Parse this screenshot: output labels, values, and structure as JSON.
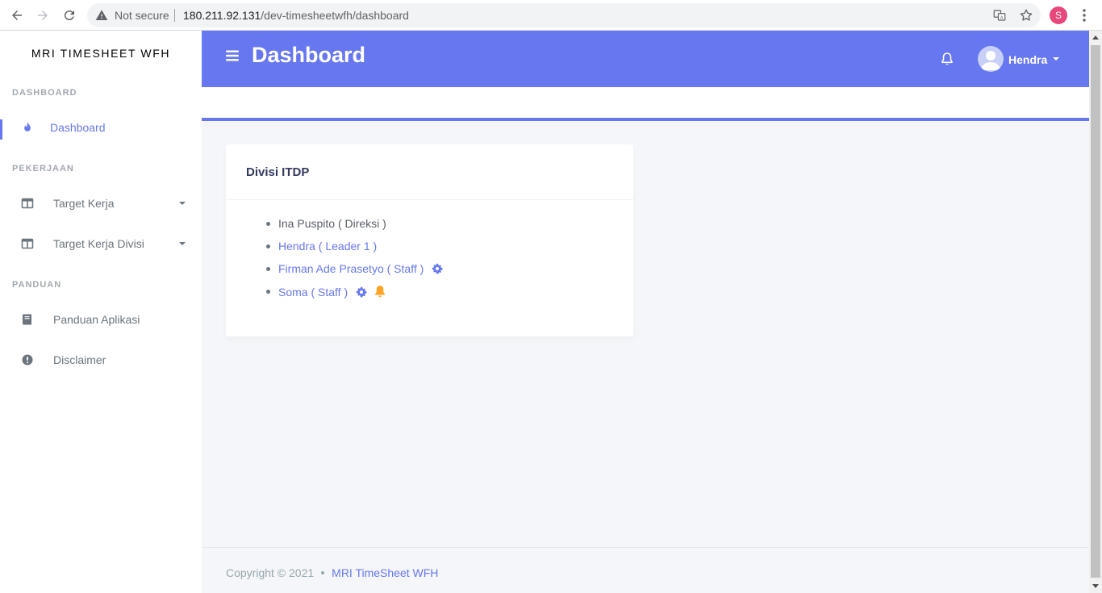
{
  "browser": {
    "security_label": "Not secure",
    "url_host": "180.211.92.131",
    "url_path": "/dev-timesheetwfh/dashboard",
    "profile_initial": "S"
  },
  "sidebar": {
    "brand": "MRI TIMESHEET WFH",
    "sections": [
      {
        "header": "DASHBOARD",
        "items": [
          {
            "label": "Dashboard",
            "icon": "fire-icon",
            "active": true
          }
        ]
      },
      {
        "header": "PEKERJAAN",
        "items": [
          {
            "label": "Target Kerja",
            "icon": "columns-icon",
            "has_dropdown": true
          },
          {
            "label": "Target Kerja Divisi",
            "icon": "columns-icon",
            "has_dropdown": true
          }
        ]
      },
      {
        "header": "PANDUAN",
        "items": [
          {
            "label": "Panduan Aplikasi",
            "icon": "book-icon"
          },
          {
            "label": "Disclaimer",
            "icon": "exclamation-circle-icon"
          }
        ]
      }
    ]
  },
  "header": {
    "title": "Dashboard",
    "user_name": "Hendra"
  },
  "card": {
    "title": "Divisi ITDP",
    "members": [
      {
        "name": "Ina Puspito ( Direksi )",
        "link": false
      },
      {
        "name": "Hendra ( Leader 1 )",
        "link": true
      },
      {
        "name": "Firman Ade Prasetyo ( Staff )",
        "link": true,
        "icons": [
          "gear-icon"
        ]
      },
      {
        "name": "Soma ( Staff )",
        "link": true,
        "icons": [
          "gear-icon",
          "bell-icon"
        ]
      }
    ]
  },
  "footer": {
    "copyright": "Copyright © 2021",
    "app_link": "MRI TimeSheet WFH"
  },
  "colors": {
    "primary": "#6777ef",
    "warning": "#ffa426",
    "background": "#f4f6f9"
  }
}
